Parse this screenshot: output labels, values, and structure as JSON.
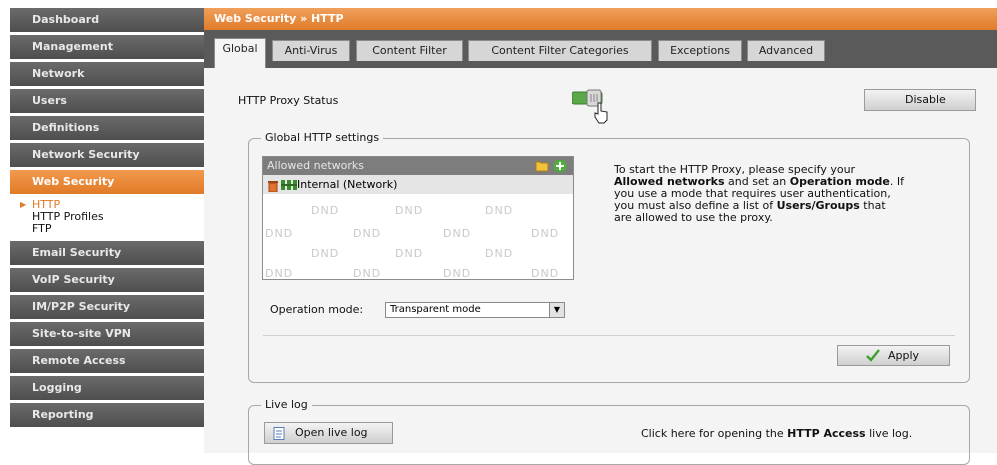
{
  "sidebar": {
    "items_top": [
      "Dashboard",
      "Management",
      "Network",
      "Users",
      "Definitions",
      "Network Security"
    ],
    "active_item": "Web Security",
    "subitems": [
      "HTTP",
      "HTTP Profiles",
      "FTP"
    ],
    "items_bottom": [
      "Email Security",
      "VoIP Security",
      "IM/P2P Security",
      "Site-to-site VPN",
      "Remote Access",
      "Logging",
      "Reporting"
    ]
  },
  "header": {
    "breadcrumb": "Web Security » HTTP"
  },
  "tabs": [
    "Global",
    "Anti-Virus",
    "Content Filter",
    "Content Filter Categories",
    "Exceptions",
    "Advanced"
  ],
  "proxy": {
    "label": "HTTP Proxy Status",
    "disable_button": "Disable"
  },
  "global_settings": {
    "legend": "Global HTTP settings",
    "allowed_networks_header": "Allowed networks",
    "network_item": "Internal (Network)",
    "dnd_text": "DND",
    "operation_mode_label": "Operation mode:",
    "operation_mode_value": "Transparent mode",
    "apply_button": "Apply",
    "help": {
      "t1": "To start the HTTP Proxy, please specify your",
      "t2_bold1": "Allowed networks",
      "t2_mid": " and set an ",
      "t2_bold2": "Operation mode",
      "t2_end": ". If",
      "t3": "you use a mode that requires user authentication,",
      "t4": "you must also define a list of ",
      "t4_bold": "Users/Groups",
      "t4_end": " that",
      "t5": "are allowed to use the proxy."
    }
  },
  "live_log": {
    "legend": "Live log",
    "button": "Open live log",
    "text_start": "Click here for opening the ",
    "text_bold": "HTTP Access",
    "text_end": " live log."
  },
  "colors": {
    "accent": "#e07a26",
    "sidebar_bg": "#5a5a5a",
    "tab_strip": "#5a5a5a",
    "content_bg": "#f4f4f4"
  },
  "icons": [
    "folder-icon",
    "add-icon",
    "delete-icon",
    "network-icon",
    "toggle-on-icon",
    "pointer-cursor-icon",
    "checkmark-icon",
    "log-icon",
    "dropdown-arrow-icon"
  ]
}
